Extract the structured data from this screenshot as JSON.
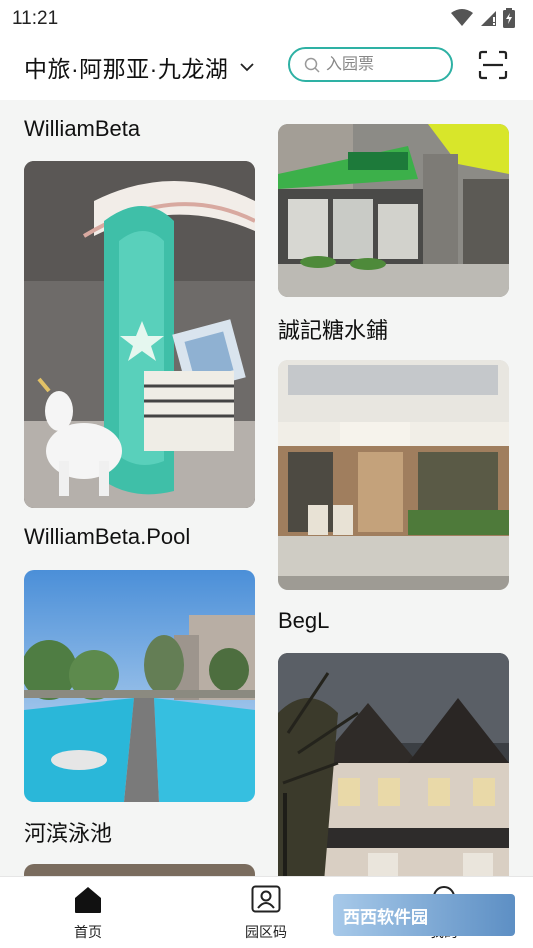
{
  "status_bar": {
    "time": "11:21"
  },
  "header": {
    "park_name": "中旅·阿那亚·九龙湖",
    "search_placeholder": "入园票"
  },
  "feed": {
    "left": [
      {
        "title": "WilliamBeta",
        "image": "williambeta-store-photo"
      },
      {
        "title": "WilliamBeta.Pool",
        "image": "pool-store-photo"
      },
      {
        "title": "河滨泳池",
        "image": "riverside-pool-photo"
      }
    ],
    "right": [
      {
        "title": "誠記糖水鋪",
        "image": "dessert-shop-photo"
      },
      {
        "title": "BegL",
        "image": "begl-bakery-photo"
      },
      {
        "title": "",
        "image": "townhouse-night-photo"
      }
    ]
  },
  "tabbar": {
    "tabs": [
      {
        "label": "首页",
        "icon": "home-icon"
      },
      {
        "label": "园区码",
        "icon": "park-code-icon"
      },
      {
        "label": "我的",
        "icon": "profile-icon"
      }
    ]
  },
  "watermark": {
    "text": "西西软件园"
  },
  "colors": {
    "accent": "#2eb1a4",
    "content_bg": "#f4f5f4"
  }
}
